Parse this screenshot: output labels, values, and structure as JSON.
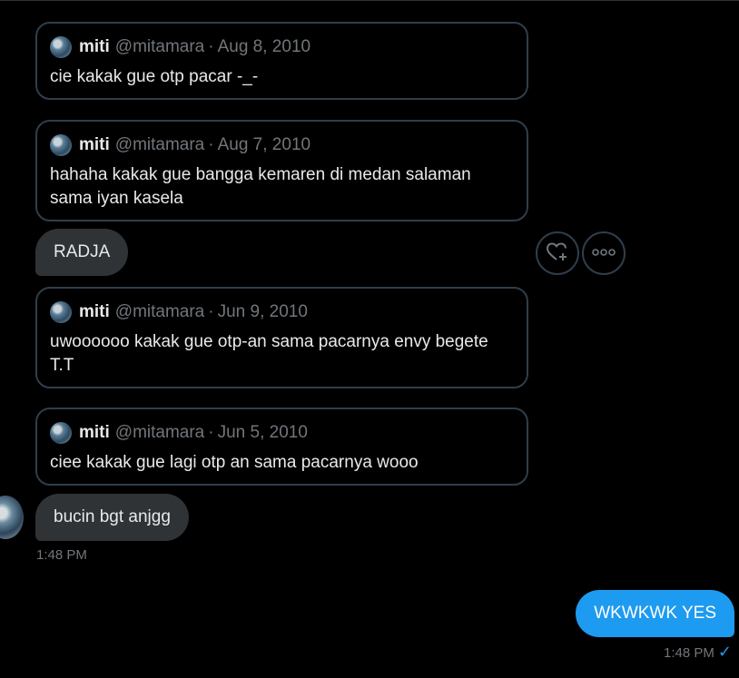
{
  "messages": [
    {
      "name": "miti",
      "handle": "@mitamara",
      "sep": "·",
      "date": "Aug 8, 2010",
      "text": "cie kakak gue otp pacar -_-"
    },
    {
      "name": "miti",
      "handle": "@mitamara",
      "sep": "·",
      "date": "Aug 7, 2010",
      "text": "hahaha kakak gue bangga kemaren di medan salaman sama iyan kasela"
    },
    {
      "name": "miti",
      "handle": "@mitamara",
      "sep": "·",
      "date": "Jun 9, 2010",
      "text": "uwoooooo kakak gue otp-an sama pacarnya envy begete T.T"
    },
    {
      "name": "miti",
      "handle": "@mitamara",
      "sep": "·",
      "date": "Jun 5, 2010",
      "text": "ciee kakak gue lagi otp an sama pacarnya wooo"
    }
  ],
  "incoming": {
    "radja": "RADJA",
    "bucin": "bucin bgt anjgg",
    "time": "1:48 PM"
  },
  "outgoing": {
    "text": "WKWKWK YES",
    "time": "1:48 PM"
  },
  "actions": {
    "react_icon": "heart-plus-icon",
    "more_icon": "more-icon"
  },
  "colors": {
    "accent": "#1d9bf0",
    "bubble_in": "#2f3336",
    "border": "#2f3e4c",
    "muted": "#71767b"
  }
}
